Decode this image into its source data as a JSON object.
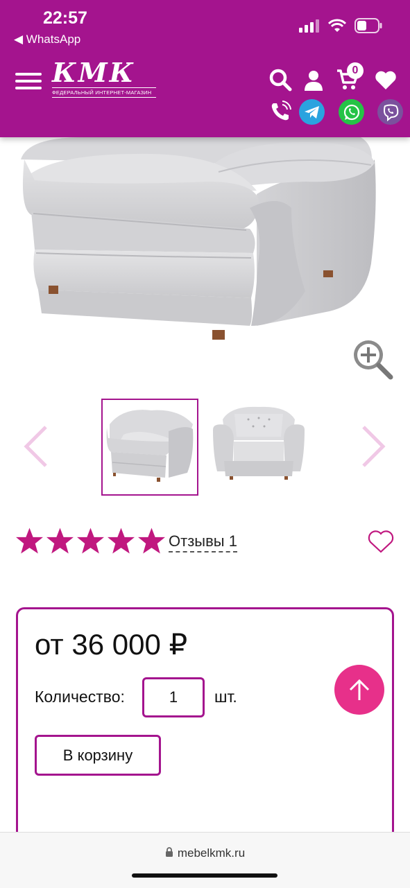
{
  "status_bar": {
    "time": "22:57",
    "back_app": "◀ WhatsApp"
  },
  "header": {
    "logo_text": "КМК",
    "logo_subtitle": "ФЕДЕРАЛЬНЫЙ ИНТЕРНЕТ-МАГАЗИН",
    "cart_count": "0",
    "icons": [
      "menu-icon",
      "search-icon",
      "user-icon",
      "cart-icon",
      "heart-icon",
      "phone-icon",
      "telegram-icon",
      "whatsapp-icon",
      "viber-icon"
    ],
    "brand_color": "#a4148e"
  },
  "gallery": {
    "icons": [
      "zoom-icon",
      "prev-arrow-icon",
      "next-arrow-icon"
    ],
    "thumbnails": [
      "armchair-side-view",
      "armchair-front-view"
    ],
    "active_thumbnail": 0
  },
  "rating": {
    "stars": 5,
    "reviews_label": "Отзывы 1",
    "star_color": "#c0187f"
  },
  "product": {
    "price": "от 36 000 ₽",
    "quantity_label": "Количество:",
    "quantity_value": "1",
    "quantity_unit": "шт.",
    "cart_button": "В корзину",
    "accent_color": "#e7308a"
  },
  "browser": {
    "url": "mebelkmk.ru"
  }
}
